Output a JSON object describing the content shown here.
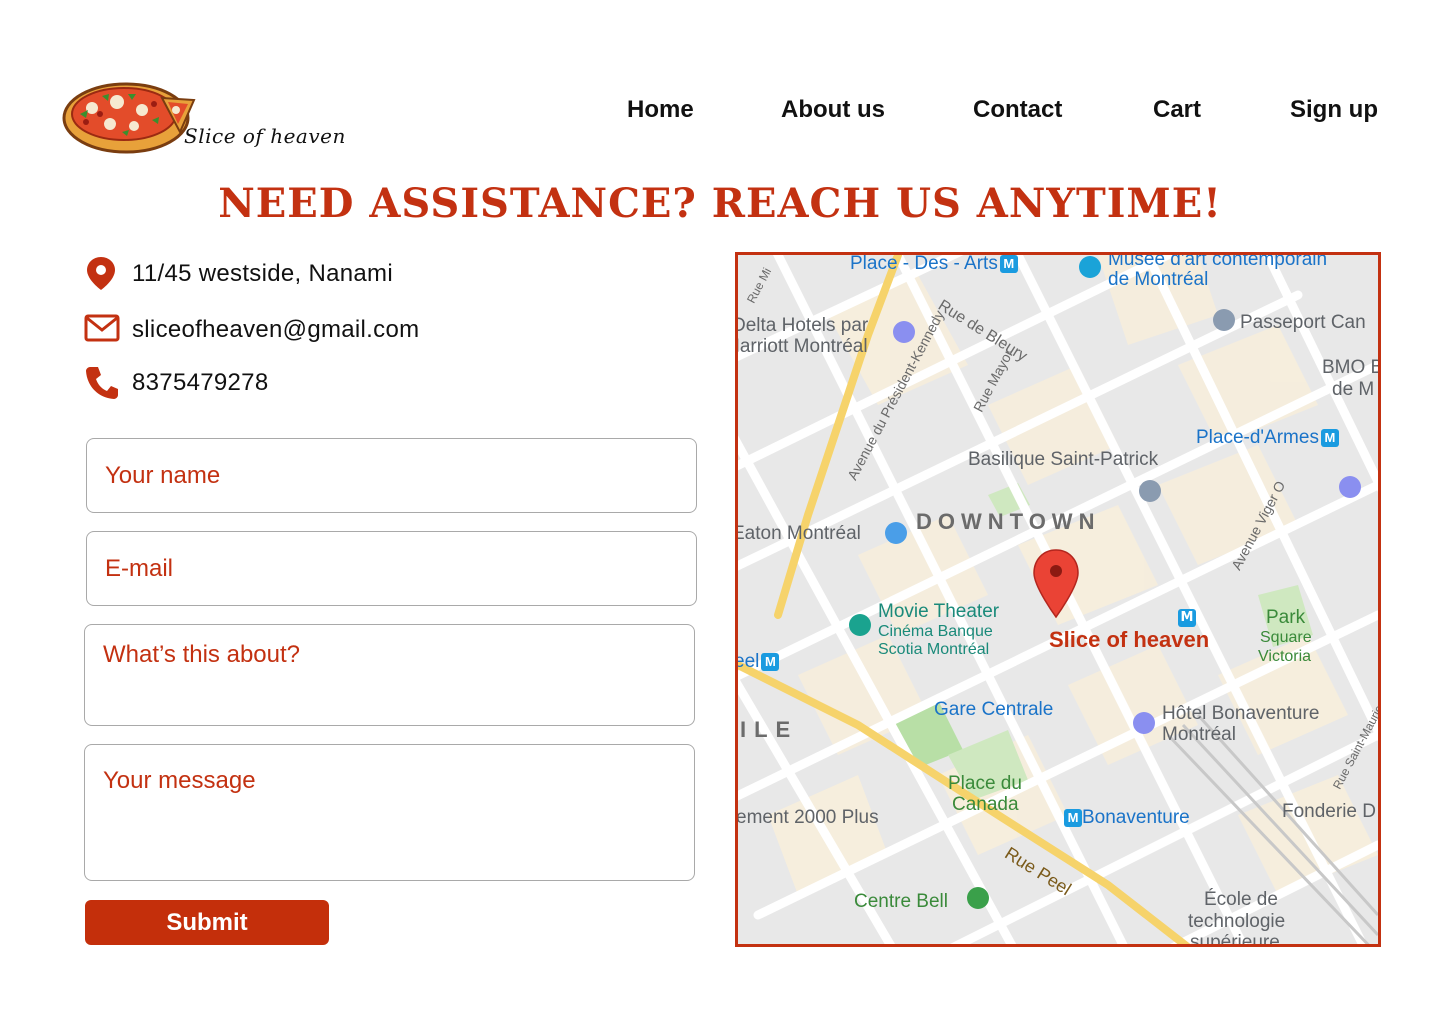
{
  "brand": {
    "name": "Slice of heaven",
    "logo_icon": "pizza-icon"
  },
  "nav": {
    "items": [
      {
        "label": "Home"
      },
      {
        "label": "About us"
      },
      {
        "label": "Contact"
      },
      {
        "label": "Cart"
      },
      {
        "label": "Sign up"
      }
    ]
  },
  "headline": "NEED ASSISTANCE? REACH US ANYTIME!",
  "contact": {
    "address": "11/45 westside, Nanami",
    "email": "sliceofheaven@gmail.com",
    "phone": "8375479278",
    "icons": [
      "location-pin-icon",
      "mail-icon",
      "phone-icon"
    ]
  },
  "form": {
    "name_placeholder": "Your name",
    "email_placeholder": "E-mail",
    "subject_placeholder": "What’s this about?",
    "message_placeholder": "Your message",
    "submit_label": "Submit"
  },
  "map": {
    "pin_label": "Slice of heaven",
    "district": "DOWNTOWN",
    "labels": {
      "place_des_arts": "Place - Des - Arts",
      "musee_1": "Musée d'art contemporain",
      "musee_2": "de Montréal",
      "delta_1": "Delta Hotels par",
      "delta_2": "Marriott Montréal",
      "rue_de_bleury": "Rue de Bleury",
      "passeport": "Passeport Can",
      "bmo_1": "BMO B",
      "bmo_2": "de M",
      "avenue_kennedy": "Avenue du Président-Kennedy",
      "rue_mayor": "Rue Mayor",
      "place_darmes": "Place-d'Armes",
      "basilique": "Basilique Saint-Patrick",
      "avenue_viger": "Avenue Viger O",
      "eaton": "Eaton Montréal",
      "movie_1": "Movie Theater",
      "movie_2": "Cinéma Banque",
      "movie_3": "Scotia Montréal",
      "park_1": "Park",
      "park_2": "Square",
      "park_3": "Victoria",
      "peel_metro": "eel",
      "ile": "ILE",
      "gare": "Gare Centrale",
      "hotel_1": "Hôtel Bonaventure",
      "hotel_2": "Montréal",
      "place_canada_1": "Place du",
      "place_canada_2": "Canada",
      "element": "ement 2000 Plus",
      "bonaventure": "Bonaventure",
      "fonderie": "Fonderie D",
      "rue_saint_maurice": "Rue Saint-Maurice",
      "rue_peel": "Rue Peel",
      "centre_bell": "Centre Bell",
      "ecole_1": "École de",
      "ecole_2": "technologie",
      "ecole_3": "supérieure",
      "rue_mi": "Rue Mi"
    },
    "colors": {
      "accent": "#c33111",
      "pin": "#ea4335",
      "metro": "#1a9be0"
    }
  }
}
